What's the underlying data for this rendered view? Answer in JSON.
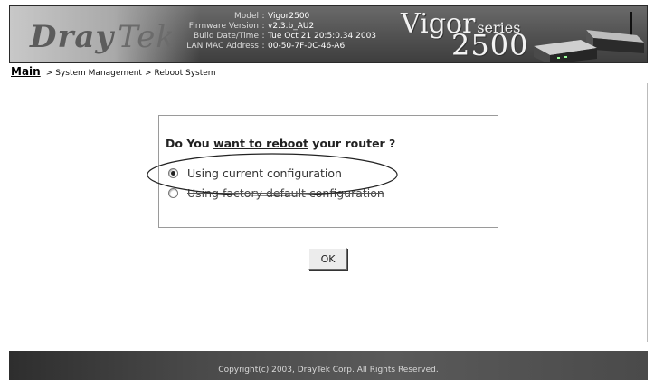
{
  "header": {
    "logo_main": "Dray",
    "logo_tek": "Tek",
    "info": [
      {
        "key": "Model",
        "value": "Vigor2500"
      },
      {
        "key": "Firmware Version",
        "value": "v2.3.b_AU2"
      },
      {
        "key": "Build Date/Time",
        "value": "Tue Oct 21 20:5:0.34 2003"
      },
      {
        "key": "LAN MAC Address",
        "value": "00-50-7F-0C-46-A6"
      }
    ],
    "product_name": "Vigor",
    "product_series": "series",
    "product_number": "2500"
  },
  "breadcrumb": {
    "main": "Main",
    "section": "System Management",
    "page": "Reboot System",
    "separator": ">"
  },
  "reboot": {
    "question_prefix": "Do You ",
    "question_link": "want to reboot",
    "question_suffix": " your router ?",
    "options": [
      {
        "label": "Using current configuration",
        "selected": true
      },
      {
        "label": "Using factory default configuration",
        "selected": false
      }
    ],
    "ok_label": "OK"
  },
  "footer": {
    "copyright": "Copyright(c) 2003, DrayTek Corp. All Rights Reserved."
  },
  "colors": {
    "banner_dark": "#3e3e3e",
    "banner_light": "#c8c8c8",
    "footer_dark": "#2e2e2e"
  },
  "icons": {
    "router": "router-device-icon",
    "annotation": "highlight-ellipse-icon"
  }
}
